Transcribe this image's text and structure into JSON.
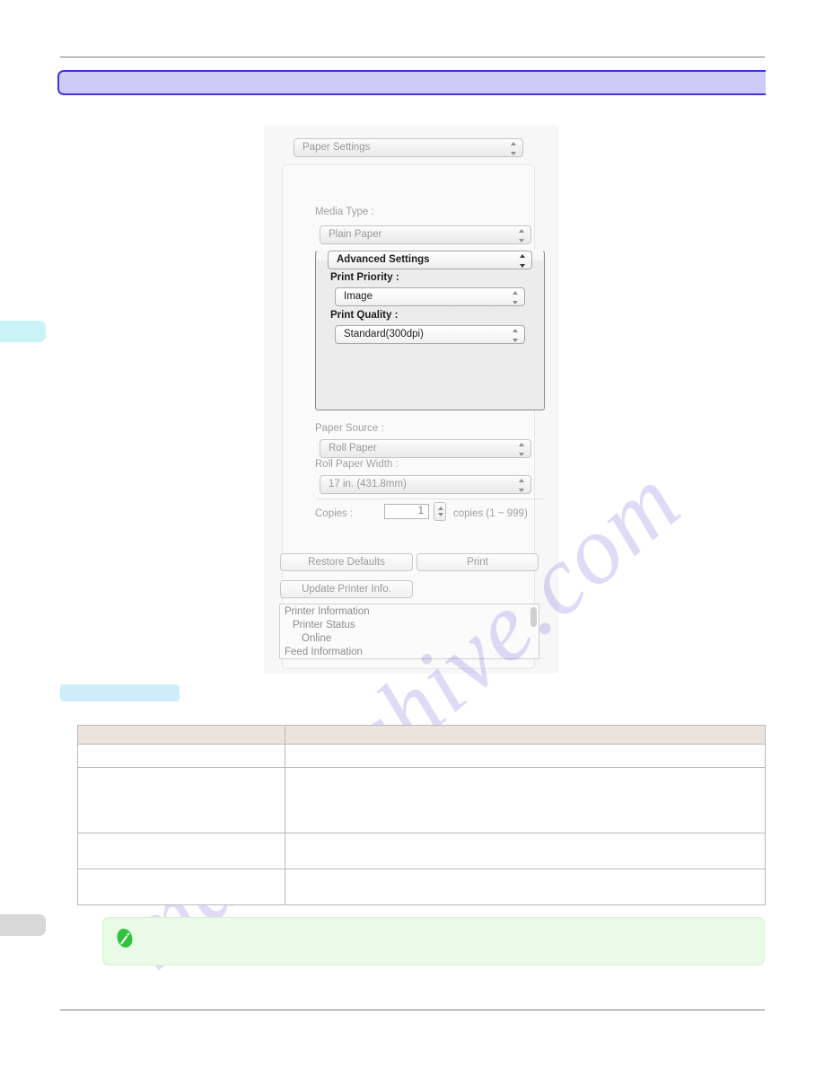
{
  "document": {
    "title_band_text": "",
    "section_chip_label": "",
    "footer_page_number": ""
  },
  "edge_tabs": [
    {
      "name": "cyan-tab",
      "label": "",
      "color": "#c9f3f6"
    },
    {
      "name": "gray-tab",
      "label": "",
      "color": "#d8d8d8"
    }
  ],
  "watermark": {
    "text": "manualshive.com",
    "color": "#5c4fd6"
  },
  "print_dialog": {
    "pane_popup": {
      "label": "Paper Settings",
      "icon": "updown-arrows-icon"
    },
    "media_type": {
      "label": "Media Type :",
      "value": "Plain Paper"
    },
    "advanced_settings": {
      "popup_label": "Advanced Settings",
      "print_priority": {
        "label": "Print Priority :",
        "value": "Image"
      },
      "print_quality": {
        "label": "Print Quality :",
        "value": "Standard(300dpi)"
      }
    },
    "paper_source": {
      "label": "Paper Source :",
      "value": "Roll Paper"
    },
    "roll_paper_width": {
      "label": "Roll Paper Width :",
      "value": "17 in. (431.8mm)"
    },
    "copies": {
      "label": "Copies :",
      "value": "1",
      "hint": "copies (1 ~ 999)"
    },
    "buttons": {
      "restore_defaults": "Restore Defaults",
      "print": "Print",
      "update_printer_info": "Update Printer Info."
    },
    "printer_information": {
      "lines": [
        "Printer Information",
        "Printer Status",
        "Online",
        "Feed Information"
      ]
    }
  },
  "table": {
    "headers": [
      "",
      ""
    ],
    "rows": [
      [
        "",
        ""
      ],
      [
        "",
        ""
      ],
      [
        "",
        ""
      ],
      [
        "",
        ""
      ]
    ]
  },
  "note": {
    "icon": "pencil-note-icon",
    "text": ""
  }
}
